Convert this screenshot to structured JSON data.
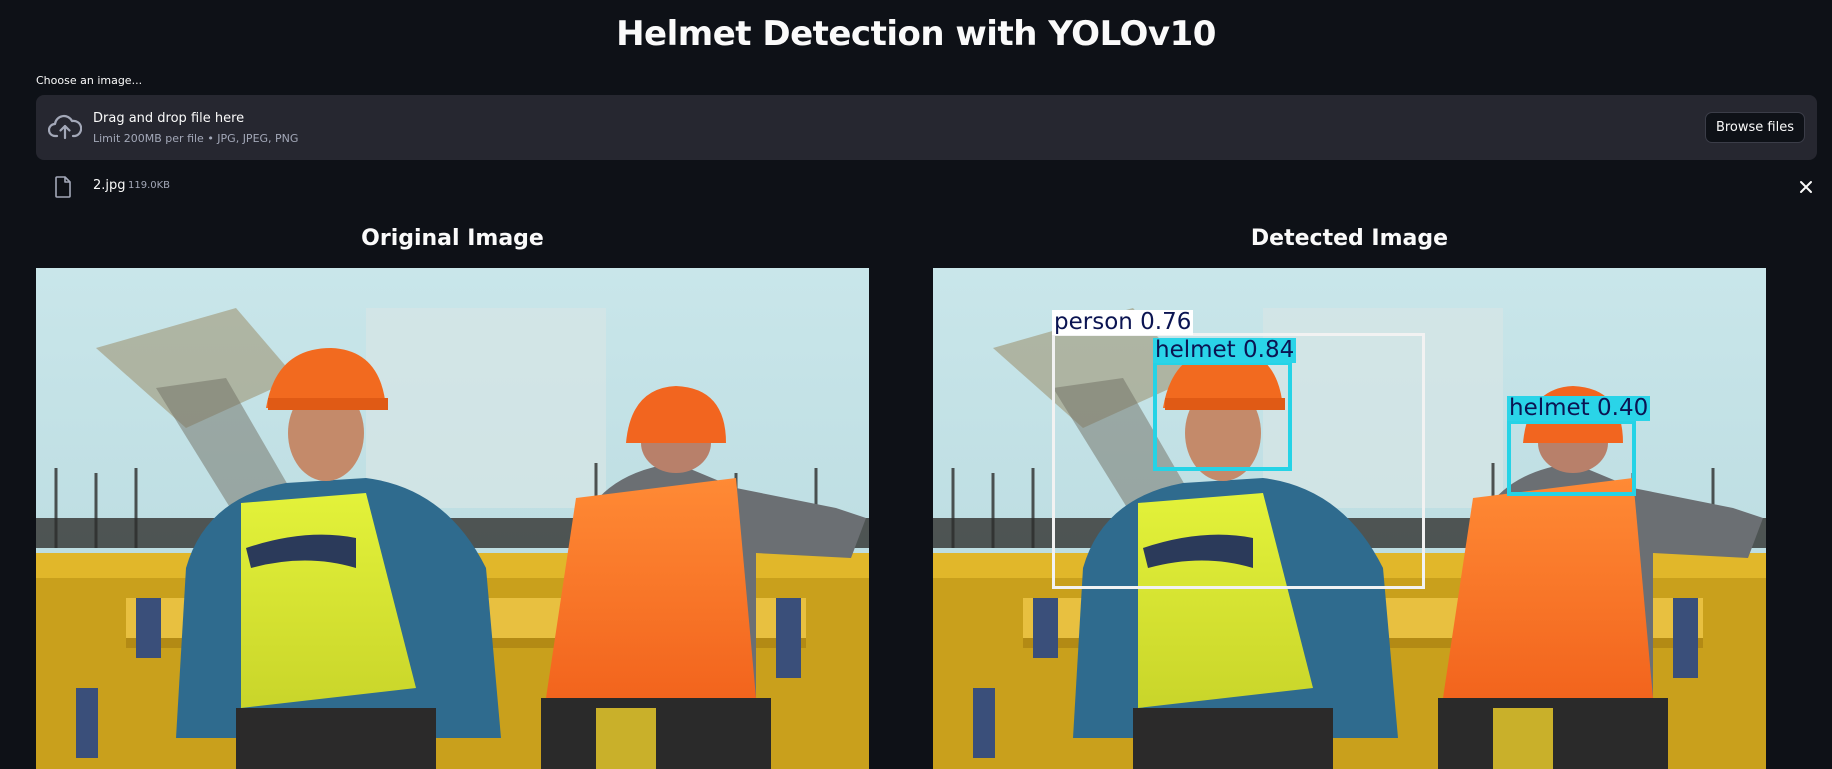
{
  "app": {
    "title": "Helmet Detection with YOLOv10"
  },
  "uploader": {
    "label": "Choose an image...",
    "drop_title": "Drag and drop file here",
    "drop_limit": "Limit 200MB per file • JPG, JPEG, PNG",
    "browse_label": "Browse files",
    "icon": "cloud-upload-icon"
  },
  "uploaded_file": {
    "name": "2.jpg",
    "size": "119.0KB",
    "icon": "file-icon",
    "remove_icon": "close-icon"
  },
  "columns": {
    "original_title": "Original Image",
    "detected_title": "Detected Image"
  },
  "detections": [
    {
      "label": "person 0.76",
      "class": "person",
      "confidence": 0.76,
      "color": "#f2f2f2",
      "label_bg": "#ffffff"
    },
    {
      "label": "helmet 0.84",
      "class": "helmet",
      "confidence": 0.84,
      "color": "#25d3e6",
      "label_bg": "#2ad4e8"
    },
    {
      "label": "helmet 0.40",
      "class": "helmet",
      "confidence": 0.4,
      "color": "#25d3e6",
      "label_bg": "#2ad4e8"
    }
  ],
  "colors": {
    "background": "#0e1117",
    "panel": "#262730",
    "text": "#fafafa",
    "muted": "#a3a8b8"
  }
}
